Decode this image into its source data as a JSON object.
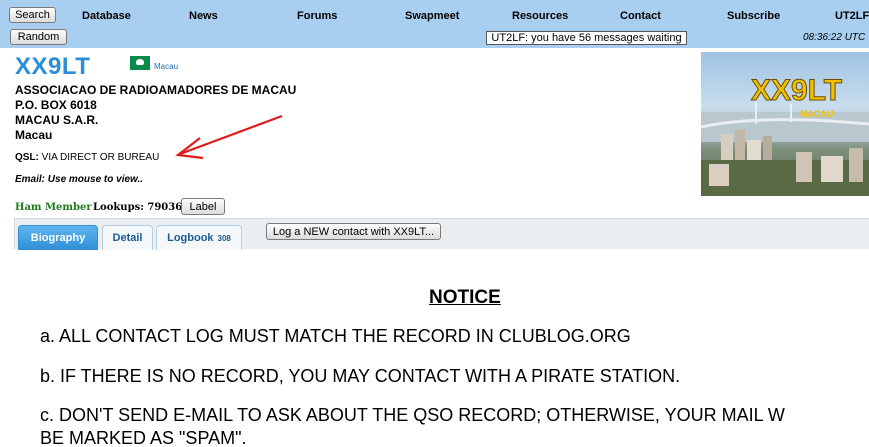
{
  "nav": {
    "search_label": "Search",
    "random_label": "Random",
    "links": [
      "Database",
      "News",
      "Forums",
      "Swapmeet",
      "Resources",
      "Contact",
      "Subscribe",
      "UT2LF"
    ],
    "message_notice": "UT2LF: you have 56 messages waiting",
    "clock": "08:36:22 UTC"
  },
  "profile": {
    "callsign": "XX9LT",
    "country": "Macau",
    "address": [
      "ASSOCIACAO DE RADIOAMADORES DE MACAU",
      "P.O. BOX 6018",
      "MACAU S.A.R.",
      "Macau"
    ],
    "qsl_label": "QSL:",
    "qsl_value": " VIA DIRECT OR BUREAU",
    "email_text": "Email: Use mouse to view..",
    "member_status": "Ham Member",
    "lookups_text": "Lookups: 79036",
    "label_button": "Label"
  },
  "photo": {
    "title": "XX9LT",
    "caption": "MACAU"
  },
  "tabs": {
    "biography": "Biography",
    "detail": "Detail",
    "logbook": "Logbook",
    "logbook_count": "308",
    "log_contact_button": "Log a NEW contact with XX9LT..."
  },
  "notice": {
    "title": "NOTICE",
    "lines": [
      "a. ALL CONTACT LOG MUST MATCH THE RECORD IN CLUBLOG.ORG",
      "b. IF THERE IS NO RECORD, YOU MAY CONTACT WITH A PIRATE STATION.",
      "c. DON'T SEND E-MAIL TO ASK ABOUT THE QSO RECORD; OTHERWISE, YOUR MAIL W",
      "BE MARKED AS \"SPAM\"."
    ]
  },
  "colors": {
    "topbar": "#a9cff0",
    "callsign": "#2b8ed8",
    "ham_member": "#1d7a1d",
    "arrow": "#e01b1b",
    "photo_title": "#f2c200"
  }
}
